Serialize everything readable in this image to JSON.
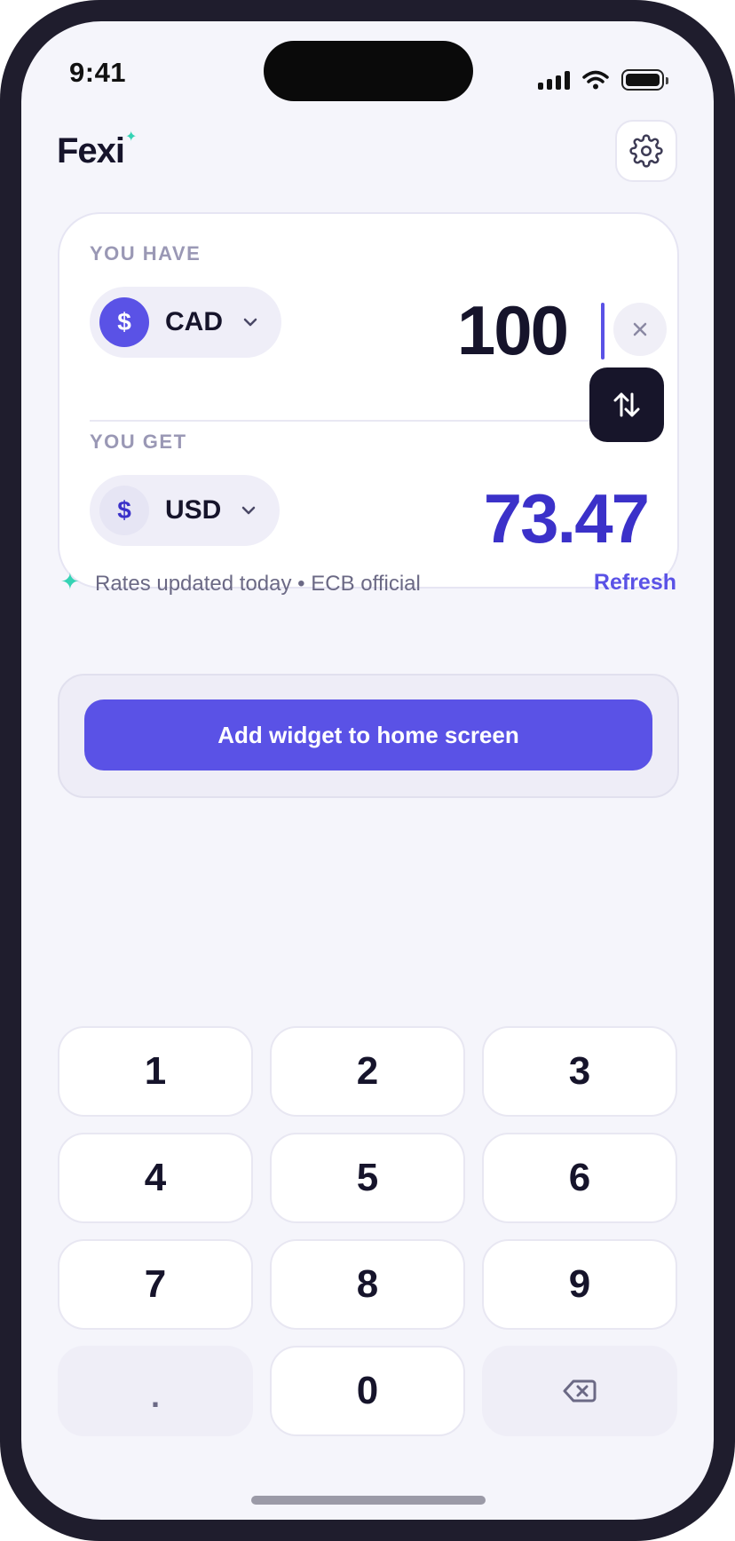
{
  "status_bar": {
    "time": "9:41"
  },
  "header": {
    "app_name": "Fexi"
  },
  "converter": {
    "from": {
      "label": "YOU HAVE",
      "currency_code": "CAD",
      "currency_symbol": "$",
      "amount": "100"
    },
    "to": {
      "label": "YOU GET",
      "currency_code": "USD",
      "currency_symbol": "$",
      "amount": "73.47"
    }
  },
  "rates": {
    "status_text": "Rates updated today • ECB official",
    "refresh_label": "Refresh"
  },
  "widget": {
    "button_label": "Add widget to home screen"
  },
  "keypad": {
    "keys": [
      "1",
      "2",
      "3",
      "4",
      "5",
      "6",
      "7",
      "8",
      "9",
      ".",
      "0"
    ],
    "backspace_icon": "backspace-icon"
  },
  "colors": {
    "accent": "#5a52e6",
    "accent_dark": "#3b31c9",
    "mint": "#34d3b4",
    "ink": "#16142b",
    "background": "#f5f5fb"
  }
}
